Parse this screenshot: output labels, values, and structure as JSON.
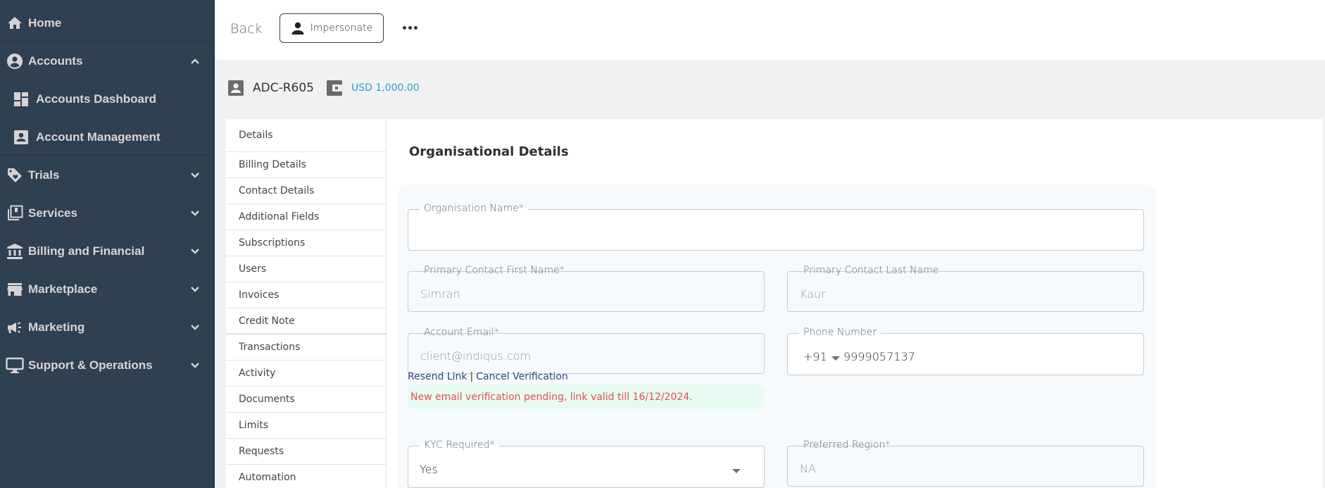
{
  "sidebar": {
    "items": [
      {
        "label": "Home",
        "icon": "home-icon"
      },
      {
        "label": "Accounts",
        "icon": "account-circle-icon",
        "expanded": true
      },
      {
        "label": "Accounts Dashboard",
        "icon": "dashboard-icon",
        "sub": true
      },
      {
        "label": "Account Management",
        "icon": "account-box-icon",
        "sub": true
      },
      {
        "label": "Trials",
        "icon": "tag-heart-icon"
      },
      {
        "label": "Services",
        "icon": "library-bookmark-icon"
      },
      {
        "label": "Billing and Financial",
        "icon": "bank-icon"
      },
      {
        "label": "Marketplace",
        "icon": "store-icon"
      },
      {
        "label": "Marketing",
        "icon": "megaphone-icon"
      },
      {
        "label": "Support & Operations",
        "icon": "monitor-icon"
      }
    ]
  },
  "topbar": {
    "back_label": "Back",
    "impersonate_label": "Impersonate",
    "more_icon": "more-horizontal-icon"
  },
  "account": {
    "id": "ADC-R605",
    "balance": "USD 1,000.00"
  },
  "tabs": [
    {
      "label": "Details",
      "active": true
    },
    {
      "label": "Billing Details"
    },
    {
      "label": "Contact Details"
    },
    {
      "label": "Additional Fields"
    },
    {
      "label": "Subscriptions"
    },
    {
      "label": "Users"
    },
    {
      "label": "Invoices"
    },
    {
      "label": "Credit Note"
    },
    {
      "label": "Transactions"
    },
    {
      "label": "Activity"
    },
    {
      "label": "Documents"
    },
    {
      "label": "Limits"
    },
    {
      "label": "Requests"
    },
    {
      "label": "Automation"
    }
  ],
  "form": {
    "title": "Organisational Details",
    "org_name": {
      "label": "Organisation Name*",
      "value": ""
    },
    "first_name": {
      "label": "Primary Contact First Name*",
      "value": "Simran"
    },
    "last_name": {
      "label": "Primary Contact Last Name",
      "value": "Kaur"
    },
    "email": {
      "label": "Account Email*",
      "value": "client@indiqus.com"
    },
    "phone": {
      "label": "Phone Number",
      "country_code": "+91",
      "value": "9999057137"
    },
    "resend_link": "Resend Link",
    "separator": "|",
    "cancel_verification": "Cancel Verification",
    "verification_notice": "New email verification pending, link valid till 16/12/2024.",
    "kyc": {
      "label": "KYC Required*",
      "value": "Yes"
    },
    "region": {
      "label": "Preferred Region*",
      "value": "NA"
    }
  },
  "colors": {
    "sidebar_bg": "#2f4050",
    "accent_blue": "#2aa0cf",
    "link_blue": "#2c4a7a",
    "error_red": "#e84e4e",
    "notice_bg": "#e6fbf1"
  }
}
